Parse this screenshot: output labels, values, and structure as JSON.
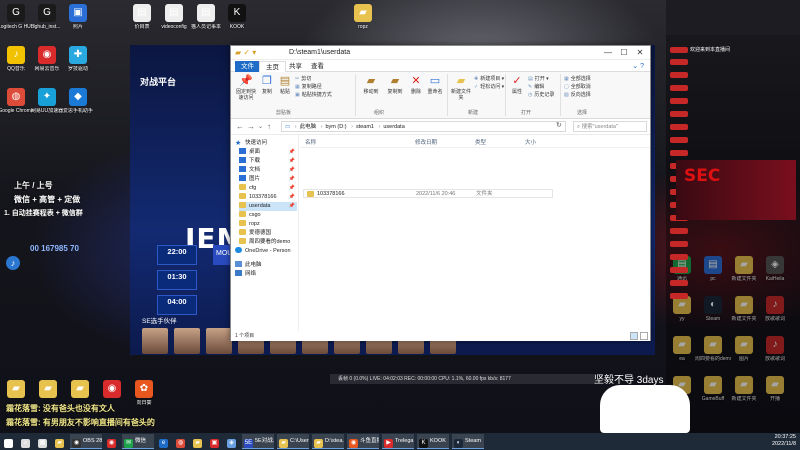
{
  "desktop_icons_left": [
    {
      "label": "Logitech G HUB",
      "color": "#1a1a1a",
      "glyph": "G"
    },
    {
      "label": "lghub_inst...",
      "color": "#1a1a1a",
      "glyph": "G"
    },
    {
      "label": "照片",
      "color": "#2b6fd6",
      "glyph": "▣"
    },
    {
      "label": "QQ音乐",
      "color": "#f2c200",
      "glyph": "♪"
    },
    {
      "label": "网易云音乐",
      "color": "#d92b2b",
      "glyph": "◉"
    },
    {
      "label": "罗技驱动",
      "color": "#2aa8e0",
      "glyph": "✚"
    },
    {
      "label": "Google Chrome",
      "color": "#dd4b39",
      "glyph": "◍"
    },
    {
      "label": "网易UU加速器",
      "color": "#18a0d8",
      "glyph": "✦"
    },
    {
      "label": "爱思手机助手",
      "color": "#1b7ad6",
      "glyph": "◆"
    }
  ],
  "desktop_icons_top": [
    {
      "label": "价目表",
      "color": "#eeeeee",
      "glyph": "▤"
    },
    {
      "label": "videoconfig",
      "color": "#eeeeee",
      "glyph": "▤"
    },
    {
      "label": "猫人员记事本",
      "color": "#eeeeee",
      "glyph": "▤"
    },
    {
      "label": "KOOK",
      "color": "#111111",
      "glyph": "K"
    },
    {
      "label": "ropz",
      "color": "#e8c24f",
      "glyph": "▰"
    }
  ],
  "desktop_icons_right": [
    {
      "label": "通讯",
      "color": "#1ea34a",
      "glyph": "▤"
    },
    {
      "label": "pc",
      "color": "#2b6fd6",
      "glyph": "▤"
    },
    {
      "label": "新建文件夹",
      "color": "#e8c24f",
      "glyph": "▰"
    },
    {
      "label": "KaiHeila",
      "color": "#555555",
      "glyph": "◈"
    },
    {
      "label": "yy",
      "color": "#e8c24f",
      "glyph": "▰"
    },
    {
      "label": "Steam",
      "color": "#1b2838",
      "glyph": "◐"
    },
    {
      "label": "新建文件夹",
      "color": "#e8c24f",
      "glyph": "▰"
    },
    {
      "label": "放歌歌词",
      "color": "#c62828",
      "glyph": "♪"
    },
    {
      "label": "ea",
      "color": "#e8c24f",
      "glyph": "▰"
    },
    {
      "label": "周四要看的demo",
      "color": "#e8c24f",
      "glyph": "▰"
    },
    {
      "label": "图片",
      "color": "#e8c24f",
      "glyph": "▰"
    },
    {
      "label": "放歌歌词",
      "color": "#c62828",
      "glyph": "♪"
    },
    {
      "label": "",
      "color": "#e8c24f",
      "glyph": "▰"
    },
    {
      "label": "GameBuff",
      "color": "#e8c24f",
      "glyph": "▰"
    },
    {
      "label": "新建文件夹",
      "color": "#e8c24f",
      "glyph": "▰"
    },
    {
      "label": "开播",
      "color": "#e8c24f",
      "glyph": "▰"
    }
  ],
  "desktop_icons_bottom": [
    {
      "label": "",
      "color": "#e8c24f",
      "glyph": "▰"
    },
    {
      "label": "",
      "color": "#e8c24f",
      "glyph": "▰"
    },
    {
      "label": "",
      "color": "#e8c24f",
      "glyph": "▰"
    },
    {
      "label": "",
      "color": "#d92b2b",
      "glyph": "◉"
    },
    {
      "label": "向日葵",
      "color": "#e8571e",
      "glyph": "✿"
    }
  ],
  "stream": {
    "logo": "对战平台",
    "big_text": "IEM",
    "times": [
      "22:00",
      "01:30",
      "04:00"
    ],
    "team": "MOU",
    "sub": "SE选手伙伴",
    "players": [
      "",
      "",
      "",
      "",
      "",
      "",
      "",
      "",
      "",
      ""
    ],
    "chips": [
      "",
      "",
      "",
      "",
      "",
      "",
      "",
      "",
      "",
      ""
    ],
    "player_names": [
      "",
      "",
      "",
      "",
      "",
      "",
      "",
      "",
      "",
      ""
    ],
    "side_text": "SEC"
  },
  "left_overlay": {
    "line1": "上午 / 上号",
    "line2": "微信 + 高管 + 定做",
    "line3": "1. 自动挂赛程表 + 微信群",
    "number": "00 167985 70"
  },
  "window": {
    "title": "D:\\steam1\\userdata",
    "tabs": [
      "文件",
      "主页",
      "共享",
      "查看"
    ],
    "ribbon": {
      "pin_label": "固定到快速访问",
      "copy_label": "复制",
      "paste_label": "粘贴",
      "cut": "剪切",
      "copy_path": "复制路径",
      "paste_shortcut": "粘贴快捷方式",
      "move_to": "移动到",
      "copy_to": "复制到",
      "delete": "删除",
      "rename": "重命名",
      "new_folder": "新建文件夹",
      "new_item": "新建项目",
      "easy_access": "轻松访问",
      "properties": "属性",
      "open": "打开",
      "edit": "编辑",
      "history": "历史记录",
      "select_all": "全部选择",
      "select_none": "全部取消",
      "invert": "反向选择",
      "groups": [
        "剪贴板",
        "组织",
        "新建",
        "打开",
        "选择"
      ]
    },
    "breadcrumb": [
      "此电脑",
      "bym (D:)",
      "steam1",
      "userdata"
    ],
    "search_placeholder": "搜索\"userdata\"",
    "nav": [
      {
        "label": "快速访问",
        "type": "star"
      },
      {
        "label": "桌面",
        "type": "blue",
        "pin": true
      },
      {
        "label": "下载",
        "type": "blue",
        "pin": true
      },
      {
        "label": "文档",
        "type": "blue",
        "pin": true
      },
      {
        "label": "图片",
        "type": "blue",
        "pin": true
      },
      {
        "label": "cfg",
        "type": "folder",
        "pin": true
      },
      {
        "label": "103378166",
        "type": "folder",
        "pin": true
      },
      {
        "label": "userdata",
        "type": "folder",
        "pin": true,
        "selected": true
      },
      {
        "label": "csgo",
        "type": "folder"
      },
      {
        "label": "ropz",
        "type": "folder"
      },
      {
        "label": "爱德德国",
        "type": "folder"
      },
      {
        "label": "周四要看的demo",
        "type": "folder"
      },
      {
        "label": "OneDrive - Person",
        "type": "cloud"
      },
      {
        "label": "此电脑",
        "type": "pc"
      },
      {
        "label": "网络",
        "type": "net"
      }
    ],
    "columns": [
      "名称",
      "修改日期",
      "类型",
      "大小"
    ],
    "rows": [
      {
        "name": "103378166",
        "date": "2022/11/6 20:46",
        "type": "文件夹",
        "size": ""
      }
    ],
    "status": "1 个项目"
  },
  "obs": {
    "text": "丢帧 0 (0.0%)   LIVE: 04:02:03   REC: 00:00:00   CPU: 1.1%, 60.00 fps   kb/s: 8177"
  },
  "watermark": "坚毅不导 3days",
  "chat_bottom": [
    "霜花落雪: 没有爸头也没有文人",
    "霜花落雪: 有男朋友不影响直播间有爸头的"
  ],
  "right_panel": {
    "header": "",
    "lines": [
      "欢迎来到本直播间",
      "",
      "",
      "",
      "",
      "",
      "",
      "",
      "",
      "",
      "",
      "",
      "",
      "",
      "",
      "",
      "",
      "",
      "",
      ""
    ]
  },
  "taskbar": {
    "items": [
      {
        "label": "",
        "color": "#ffffff",
        "glyph": "⊞"
      },
      {
        "label": "",
        "color": "#dddddd",
        "glyph": "⌕"
      },
      {
        "label": "",
        "color": "#dddddd",
        "glyph": "▦"
      },
      {
        "label": "",
        "color": "#e8c24f",
        "glyph": "▰"
      },
      {
        "label": "OBS 28...",
        "color": "#333333",
        "glyph": "◉"
      },
      {
        "label": "",
        "color": "#d92b2b",
        "glyph": "◉"
      },
      {
        "label": "微信",
        "color": "#1ea34a",
        "glyph": "✉"
      },
      {
        "label": "",
        "color": "#1e6cc7",
        "glyph": "e"
      },
      {
        "label": "",
        "color": "#dd4b39",
        "glyph": "◍"
      },
      {
        "label": "",
        "color": "#e8c24f",
        "glyph": "▰"
      },
      {
        "label": "",
        "color": "#d92b2b",
        "glyph": "▣"
      },
      {
        "label": "",
        "color": "#6aa0e0",
        "glyph": "◈"
      },
      {
        "label": "5E对战...",
        "color": "#2b4bbf",
        "glyph": "5E"
      },
      {
        "label": "C:\\Users...",
        "color": "#e8c24f",
        "glyph": "▰"
      },
      {
        "label": "D:\\stea...",
        "color": "#e8c24f",
        "glyph": "▰"
      },
      {
        "label": "斗鱼直播...",
        "color": "#e8571e",
        "glyph": "◉"
      },
      {
        "label": "Trelega...",
        "color": "#d92b2b",
        "glyph": "▶"
      },
      {
        "label": "KOOK",
        "color": "#111111",
        "glyph": "K"
      },
      {
        "label": "Steam",
        "color": "#1b2838",
        "glyph": "◐"
      }
    ],
    "time": "20:37:25",
    "date": "2022/11/8"
  }
}
